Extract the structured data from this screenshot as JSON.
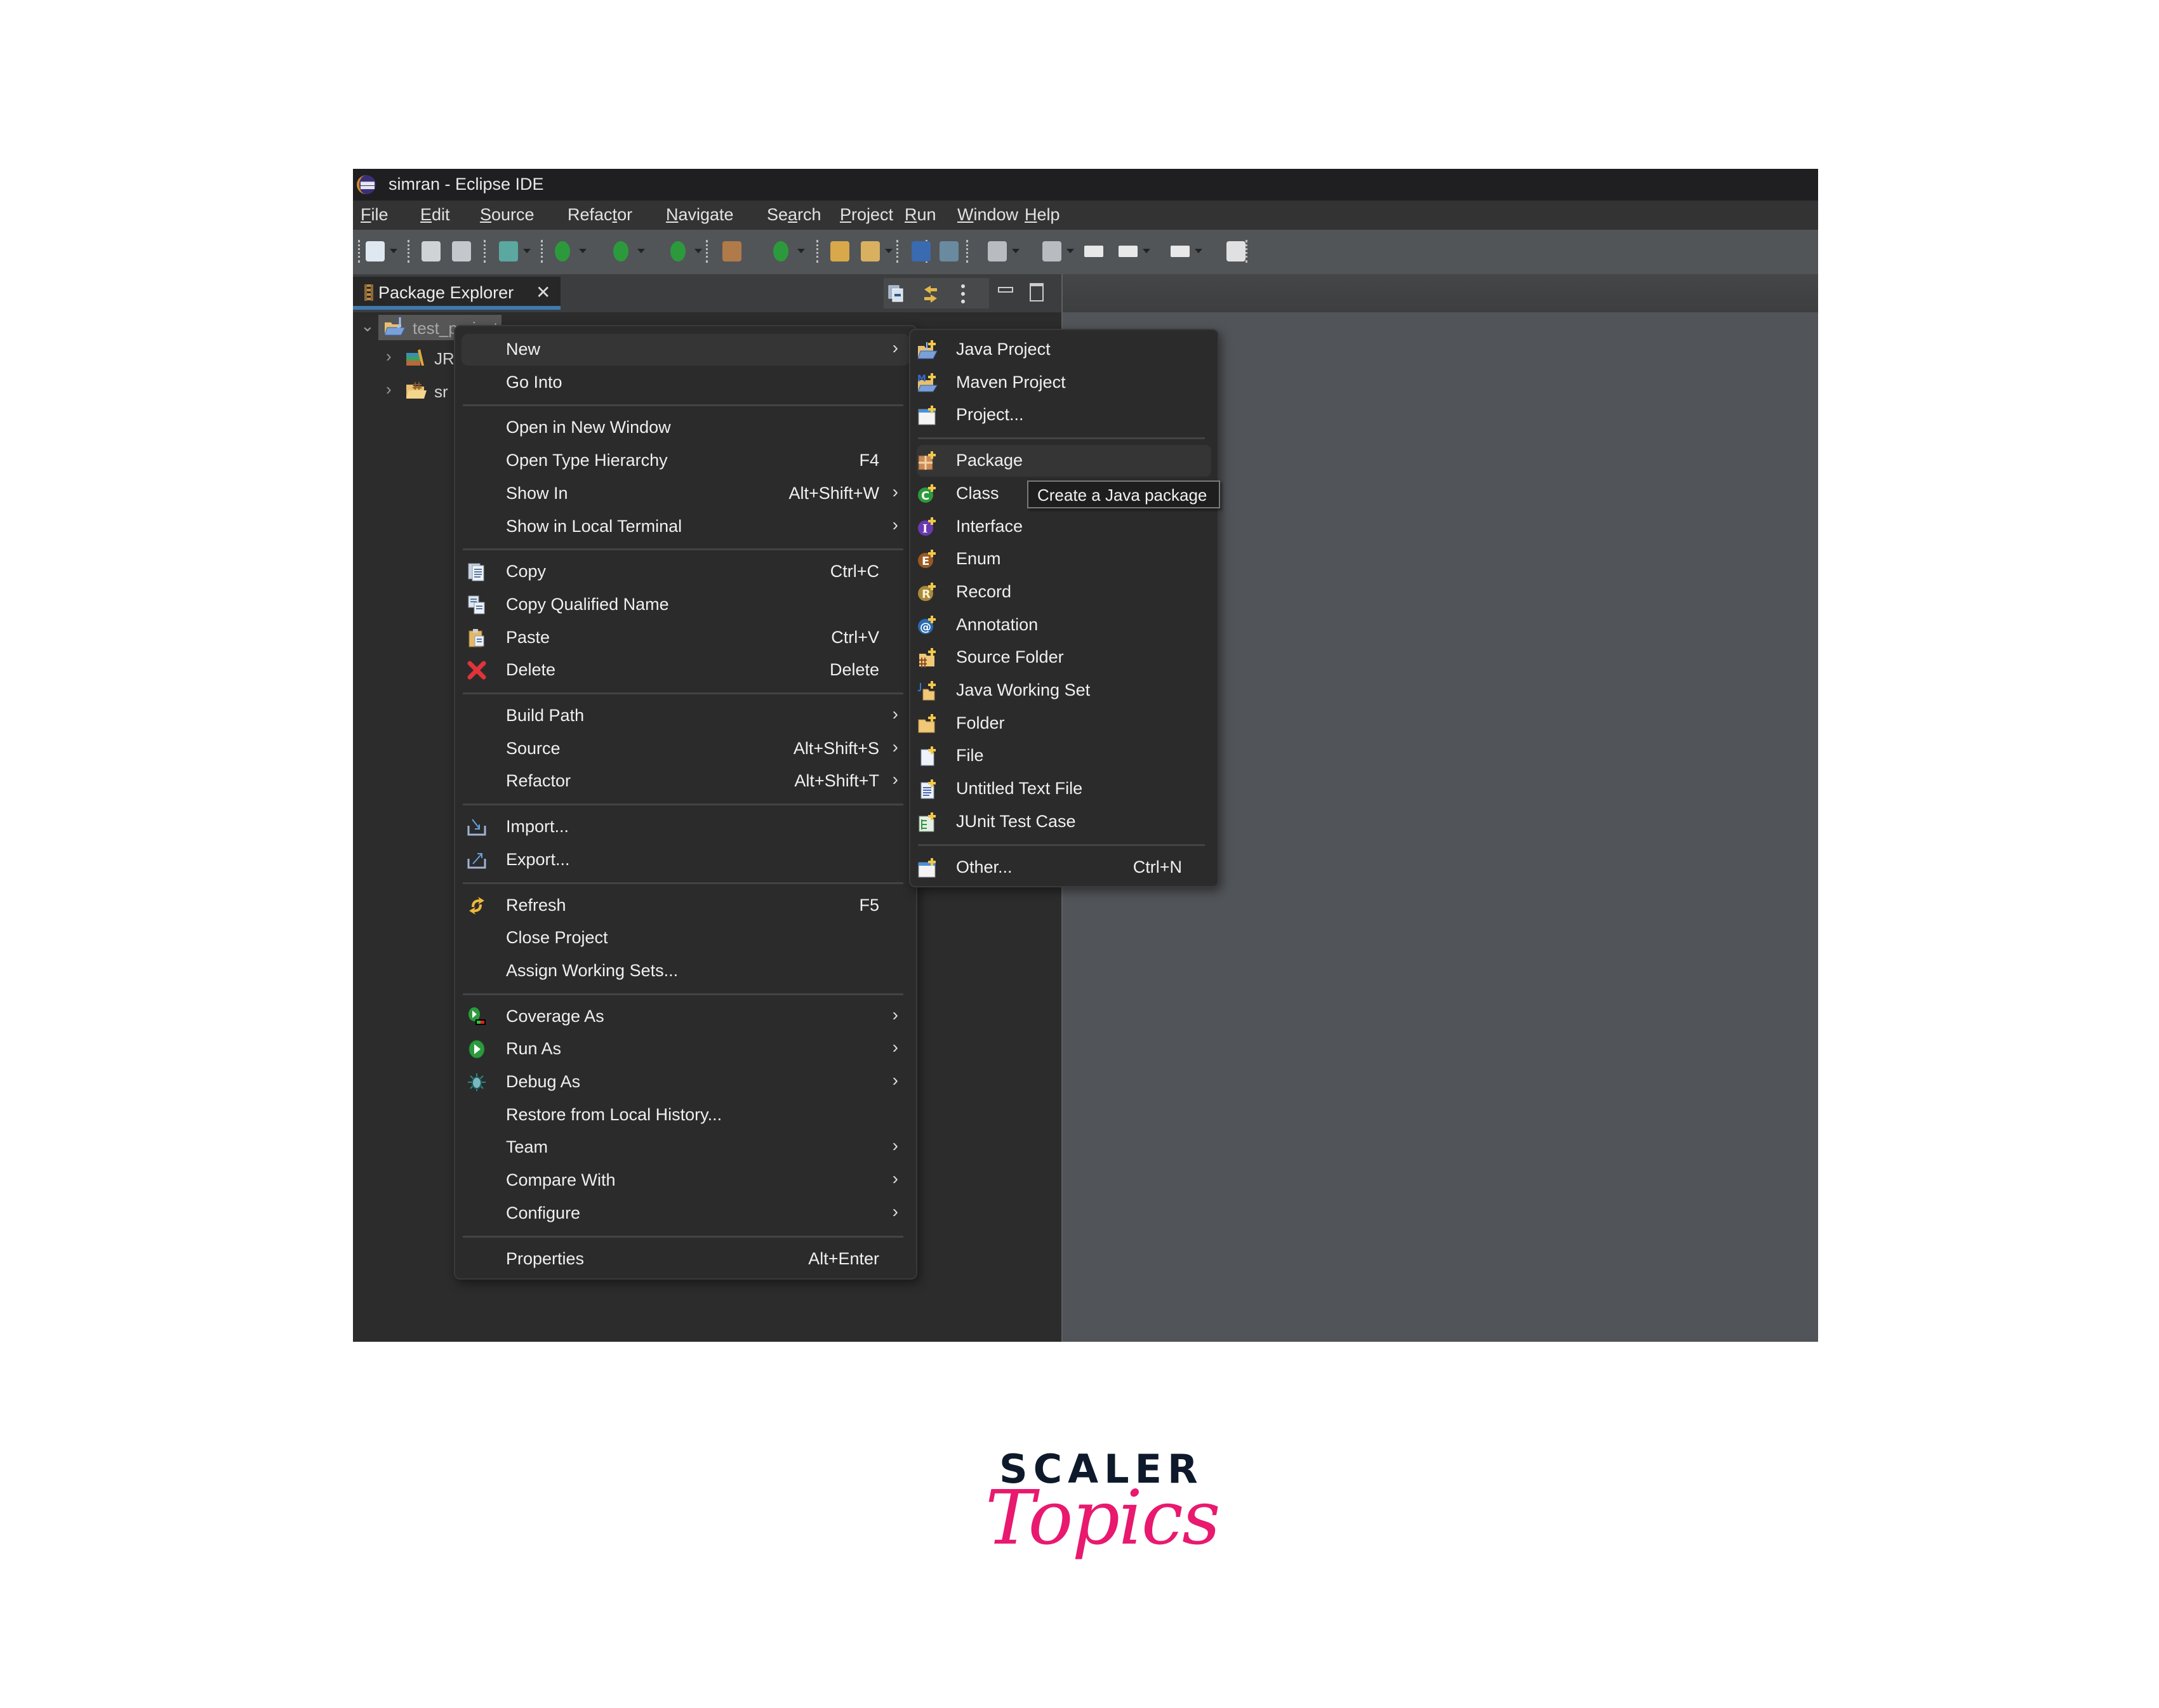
{
  "window": {
    "title": "simran - Eclipse IDE"
  },
  "menubar": {
    "items": [
      {
        "label": "File",
        "mnemonic": "F"
      },
      {
        "label": "Edit",
        "mnemonic": "E"
      },
      {
        "label": "Source",
        "mnemonic": "S"
      },
      {
        "label": "Refactor",
        "mnemonic": "t"
      },
      {
        "label": "Navigate",
        "mnemonic": "N"
      },
      {
        "label": "Search",
        "mnemonic": "a"
      },
      {
        "label": "Project",
        "mnemonic": "P"
      },
      {
        "label": "Run",
        "mnemonic": "R"
      },
      {
        "label": "Window",
        "mnemonic": "W"
      },
      {
        "label": "Help",
        "mnemonic": "H"
      }
    ]
  },
  "toolbar": {
    "icons": [
      "new-wizard-icon",
      "save-icon",
      "save-all-icon",
      "debug-icon",
      "run-icon",
      "coverage-icon",
      "run-external-tool-icon",
      "new-java-package-icon",
      "new-java-class-icon",
      "open-type-icon",
      "open-task-icon",
      "toggle-mark-occurrences-icon",
      "toggle-block-selection-icon",
      "next-annotation-icon",
      "previous-annotation-icon",
      "last-edit-location-icon",
      "back-icon",
      "forward-icon",
      "open-perspective-icon"
    ]
  },
  "package_explorer": {
    "tab_label": "Package Explorer",
    "tree": [
      {
        "label": "test_project",
        "expanded": true,
        "selected": true
      },
      {
        "label": "JRE System Library",
        "visible_text": "JR",
        "expanded": false
      },
      {
        "label": "src",
        "visible_text": "sr",
        "expanded": false
      }
    ]
  },
  "context_menu": {
    "groups": [
      [
        {
          "label": "New",
          "shortcut": "",
          "submenu": true,
          "icon": "",
          "highlighted": true
        },
        {
          "label": "Go Into",
          "shortcut": "",
          "submenu": false,
          "icon": ""
        }
      ],
      [
        {
          "label": "Open in New Window",
          "shortcut": "",
          "submenu": false,
          "icon": ""
        },
        {
          "label": "Open Type Hierarchy",
          "shortcut": "F4",
          "submenu": false,
          "icon": ""
        },
        {
          "label": "Show In",
          "shortcut": "Alt+Shift+W",
          "submenu": true,
          "icon": ""
        },
        {
          "label": "Show in Local Terminal",
          "shortcut": "",
          "submenu": true,
          "icon": ""
        }
      ],
      [
        {
          "label": "Copy",
          "shortcut": "Ctrl+C",
          "submenu": false,
          "icon": "copy-icon"
        },
        {
          "label": "Copy Qualified Name",
          "shortcut": "",
          "submenu": false,
          "icon": "copy-qualified-name-icon"
        },
        {
          "label": "Paste",
          "shortcut": "Ctrl+V",
          "submenu": false,
          "icon": "paste-icon"
        },
        {
          "label": "Delete",
          "shortcut": "Delete",
          "submenu": false,
          "icon": "delete-icon"
        }
      ],
      [
        {
          "label": "Build Path",
          "shortcut": "",
          "submenu": true,
          "icon": ""
        },
        {
          "label": "Source",
          "shortcut": "Alt+Shift+S",
          "submenu": true,
          "icon": ""
        },
        {
          "label": "Refactor",
          "shortcut": "Alt+Shift+T",
          "submenu": true,
          "icon": ""
        }
      ],
      [
        {
          "label": "Import...",
          "shortcut": "",
          "submenu": false,
          "icon": "import-icon"
        },
        {
          "label": "Export...",
          "shortcut": "",
          "submenu": false,
          "icon": "export-icon"
        }
      ],
      [
        {
          "label": "Refresh",
          "shortcut": "F5",
          "submenu": false,
          "icon": "refresh-icon"
        },
        {
          "label": "Close Project",
          "shortcut": "",
          "submenu": false,
          "icon": ""
        },
        {
          "label": "Assign Working Sets...",
          "shortcut": "",
          "submenu": false,
          "icon": ""
        }
      ],
      [
        {
          "label": "Coverage As",
          "shortcut": "",
          "submenu": true,
          "icon": "coverage-icon"
        },
        {
          "label": "Run As",
          "shortcut": "",
          "submenu": true,
          "icon": "run-icon"
        },
        {
          "label": "Debug As",
          "shortcut": "",
          "submenu": true,
          "icon": "debug-icon"
        },
        {
          "label": "Restore from Local History...",
          "shortcut": "",
          "submenu": false,
          "icon": ""
        },
        {
          "label": "Team",
          "shortcut": "",
          "submenu": true,
          "icon": ""
        },
        {
          "label": "Compare With",
          "shortcut": "",
          "submenu": true,
          "icon": ""
        },
        {
          "label": "Configure",
          "shortcut": "",
          "submenu": true,
          "icon": ""
        }
      ],
      [
        {
          "label": "Properties",
          "shortcut": "Alt+Enter",
          "submenu": false,
          "icon": ""
        }
      ]
    ]
  },
  "new_submenu": {
    "groups": [
      [
        {
          "label": "Java Project",
          "shortcut": "",
          "icon": "java-project-icon"
        },
        {
          "label": "Maven Project",
          "shortcut": "",
          "icon": "maven-project-icon"
        },
        {
          "label": "Project...",
          "shortcut": "",
          "icon": "project-icon"
        }
      ],
      [
        {
          "label": "Package",
          "shortcut": "",
          "icon": "package-icon",
          "highlighted": true
        },
        {
          "label": "Class",
          "shortcut": "",
          "icon": "class-icon"
        },
        {
          "label": "Interface",
          "shortcut": "",
          "icon": "interface-icon"
        },
        {
          "label": "Enum",
          "shortcut": "",
          "icon": "enum-icon"
        },
        {
          "label": "Record",
          "shortcut": "",
          "icon": "record-icon"
        },
        {
          "label": "Annotation",
          "shortcut": "",
          "icon": "annotation-icon"
        },
        {
          "label": "Source Folder",
          "shortcut": "",
          "icon": "source-folder-icon"
        },
        {
          "label": "Java Working Set",
          "shortcut": "",
          "icon": "java-working-set-icon"
        },
        {
          "label": "Folder",
          "shortcut": "",
          "icon": "folder-icon"
        },
        {
          "label": "File",
          "shortcut": "",
          "icon": "file-icon"
        },
        {
          "label": "Untitled Text File",
          "shortcut": "",
          "icon": "text-file-icon"
        },
        {
          "label": "JUnit Test Case",
          "shortcut": "",
          "icon": "junit-test-case-icon"
        }
      ],
      [
        {
          "label": "Other...",
          "shortcut": "Ctrl+N",
          "icon": "other-wizard-icon"
        }
      ]
    ]
  },
  "tooltip": {
    "text": "Create a Java package"
  },
  "branding": {
    "line1": "SCALER",
    "line2": "Topics",
    "colors": {
      "line1": "#0e1a2b",
      "line2": "#e8196e"
    }
  }
}
